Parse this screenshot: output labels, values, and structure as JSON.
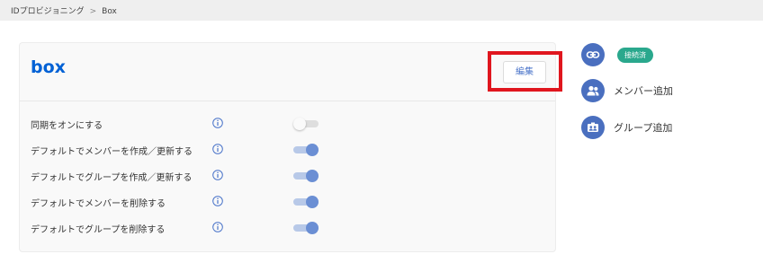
{
  "breadcrumb": {
    "parent": "IDプロビジョニング",
    "separator": ">",
    "current": "Box"
  },
  "provider": {
    "logo_text": "box",
    "logo_color": "#0061d5"
  },
  "card": {
    "edit_label": "編集"
  },
  "settings": [
    {
      "label": "同期をオンにする",
      "enabled": false
    },
    {
      "label": "デフォルトでメンバーを作成／更新する",
      "enabled": true
    },
    {
      "label": "デフォルトでグループを作成／更新する",
      "enabled": true
    },
    {
      "label": "デフォルトでメンバーを削除する",
      "enabled": true
    },
    {
      "label": "デフォルトでグループを削除する",
      "enabled": true
    }
  ],
  "sidebar": {
    "connection_status": "接続済",
    "add_member_label": "メンバー追加",
    "add_group_label": "グループ追加"
  },
  "colors": {
    "accent": "#4a6fbf",
    "status_green": "#2aa88d",
    "highlight_red": "#e0161e",
    "toggle_on": "#6b8fd4"
  }
}
